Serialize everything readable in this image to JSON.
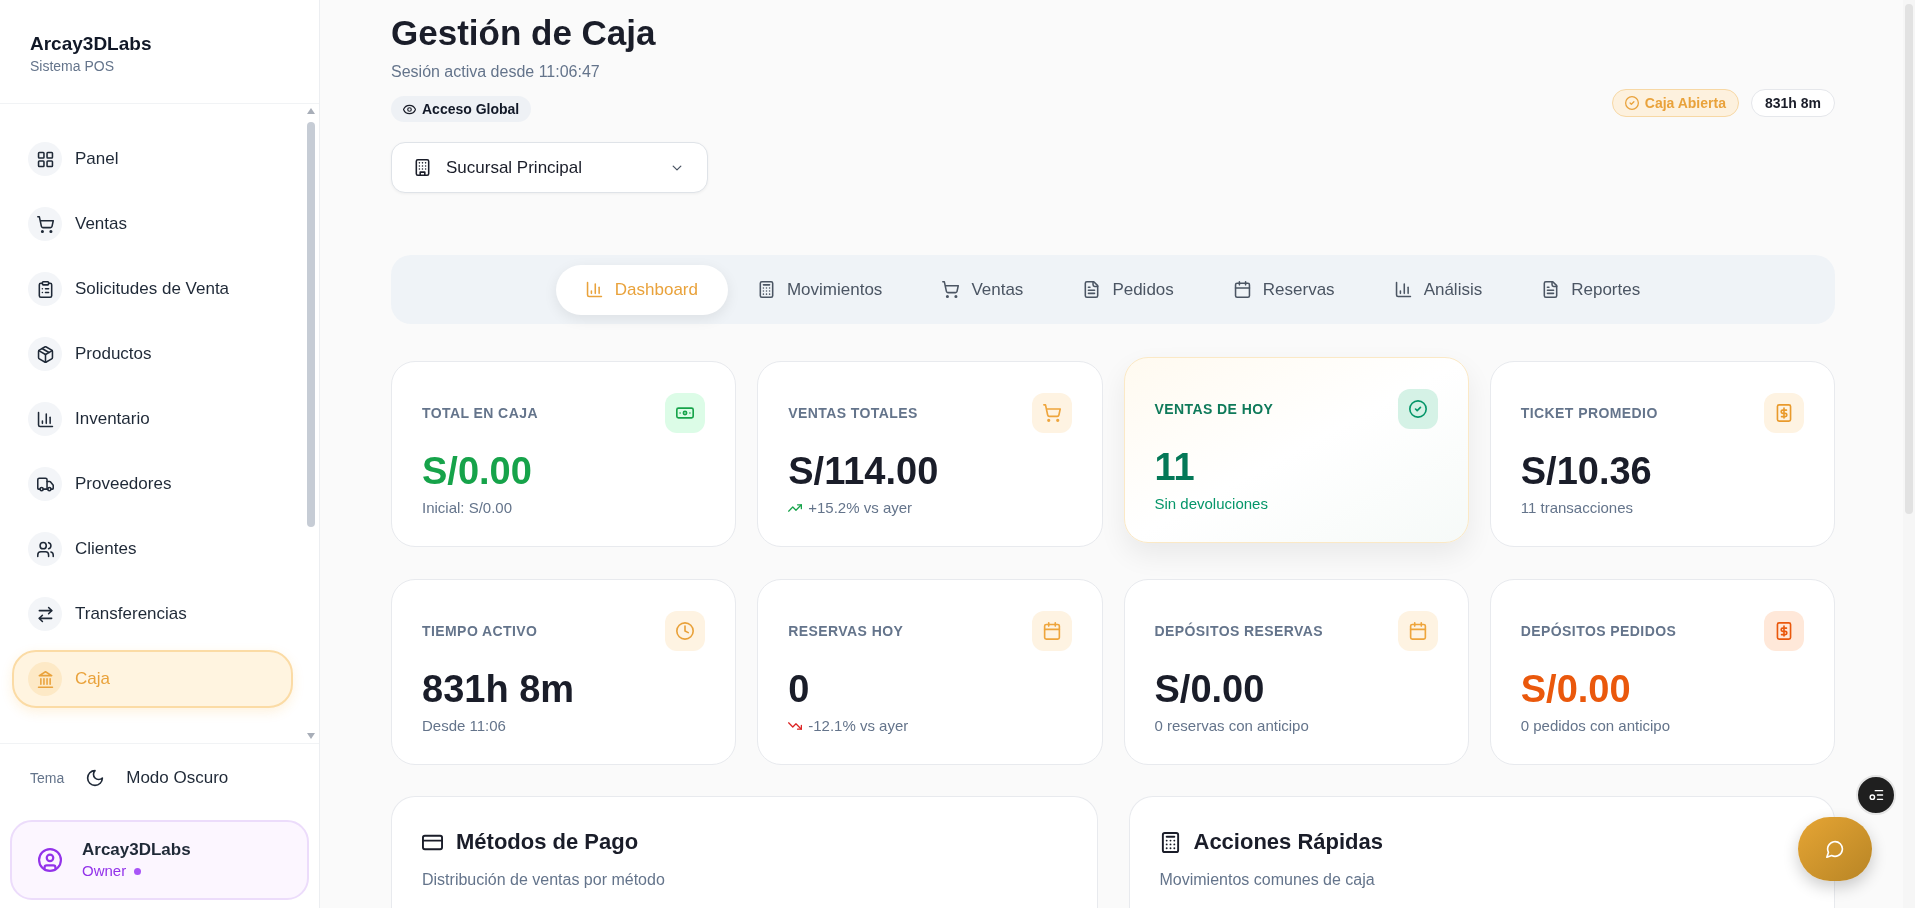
{
  "sidebar": {
    "brand": "Arcay3DLabs",
    "subtitle": "Sistema POS",
    "items": [
      {
        "label": "Panel",
        "selected": false
      },
      {
        "label": "Ventas",
        "selected": false
      },
      {
        "label": "Solicitudes de Venta",
        "selected": false
      },
      {
        "label": "Productos",
        "selected": false
      },
      {
        "label": "Inventario",
        "selected": false
      },
      {
        "label": "Proveedores",
        "selected": false
      },
      {
        "label": "Clientes",
        "selected": false
      },
      {
        "label": "Transferencias",
        "selected": false
      },
      {
        "label": "Caja",
        "selected": true
      }
    ],
    "theme": {
      "label": "Tema",
      "toggle": "Modo Oscuro"
    },
    "user": {
      "name": "Arcay3DLabs",
      "role": "Owner",
      "online": true
    }
  },
  "header": {
    "title": "Gestión de Caja",
    "session": "Sesión activa desde 11:06:47",
    "access_badge": "Acceso Global",
    "branch_select": {
      "value": "Sucursal Principal"
    },
    "status_badge": "Caja Abierta",
    "uptime_badge": "831h 8m"
  },
  "tabs": [
    {
      "label": "Dashboard",
      "selected": true
    },
    {
      "label": "Movimientos",
      "selected": false
    },
    {
      "label": "Ventas",
      "selected": false
    },
    {
      "label": "Pedidos",
      "selected": false
    },
    {
      "label": "Reservas",
      "selected": false
    },
    {
      "label": "Análisis",
      "selected": false
    },
    {
      "label": "Reportes",
      "selected": false
    }
  ],
  "stats": [
    {
      "kind": "plain",
      "label": "TOTAL EN CAJA",
      "value": "S/0.00",
      "note": "Inicial: S/0.00",
      "color": "#16a34a",
      "highlighted": false
    },
    {
      "kind": "rising",
      "label": "VENTAS TOTALES",
      "value": "S/114.00",
      "note": "+15.2% vs ayer",
      "color": "#1a1d29",
      "highlighted": false
    },
    {
      "kind": "plain",
      "label": "VENTAS DE HOY",
      "value": "11",
      "note": "Sin devoluciones",
      "color": "#047857",
      "highlighted": true
    },
    {
      "kind": "plain",
      "label": "TICKET PROMEDIO",
      "value": "S/10.36",
      "note": "11 transacciones",
      "color": "#1a1d29",
      "highlighted": false
    },
    {
      "kind": "plain",
      "label": "TIEMPO ACTIVO",
      "value": "831h 8m",
      "note": "Desde 11:06",
      "color": "#1a1d29",
      "highlighted": false
    },
    {
      "kind": "falling",
      "label": "RESERVAS HOY",
      "value": "0",
      "note": "-12.1% vs ayer",
      "color": "#1a1d29",
      "highlighted": false
    },
    {
      "kind": "plain",
      "label": "DEPÓSITOS RESERVAS",
      "value": "S/0.00",
      "note": "0 reservas con anticipo",
      "color": "#1a1d29",
      "highlighted": false
    },
    {
      "kind": "plain",
      "label": "DEPÓSITOS PEDIDOS",
      "value": "S/0.00",
      "note": "0 pedidos con anticipo",
      "color": "#ea580c",
      "highlighted": false
    }
  ],
  "panels": [
    {
      "title": "Métodos de Pago",
      "subtitle": "Distribución de ventas por método"
    },
    {
      "title": "Acciones Rápidas",
      "subtitle": "Movimientos comunes de caja"
    }
  ]
}
